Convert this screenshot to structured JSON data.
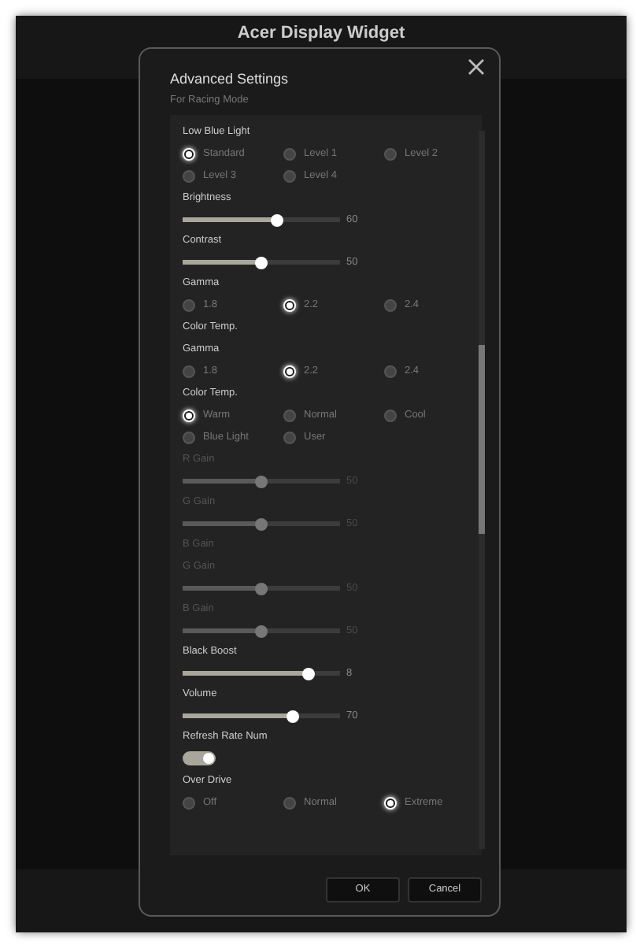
{
  "app": {
    "title": "Acer Display Widget"
  },
  "dialog": {
    "title": "Advanced Settings",
    "subtitle": "For Racing Mode",
    "sections": [
      {
        "kind": "radio",
        "label": "Low Blue Light",
        "options": [
          {
            "label": "Standard",
            "selected": true
          },
          {
            "label": "Level 1",
            "selected": false
          },
          {
            "label": "Level 2",
            "selected": false
          },
          {
            "label": "Level 3",
            "selected": false
          },
          {
            "label": "Level 4",
            "selected": false
          }
        ]
      },
      {
        "kind": "slider",
        "label": "Brightness",
        "disabled": false,
        "level": 0.6,
        "reading": "60"
      },
      {
        "kind": "slider",
        "label": "Contrast",
        "disabled": false,
        "level": 0.5,
        "reading": "50"
      },
      {
        "kind": "radio",
        "label": "Gamma",
        "options": [
          {
            "label": "1.8",
            "selected": false
          },
          {
            "label": "2.2",
            "selected": true
          },
          {
            "label": "2.4",
            "selected": false
          }
        ]
      },
      {
        "kind": "heading",
        "label": "Color Temp.",
        "disabled": false
      },
      {
        "kind": "radio",
        "label": "Gamma",
        "options": [
          {
            "label": "1.8",
            "selected": false
          },
          {
            "label": "2.2",
            "selected": true
          },
          {
            "label": "2.4",
            "selected": false
          }
        ]
      },
      {
        "kind": "radio",
        "label": "Color Temp.",
        "options": [
          {
            "label": "Warm",
            "selected": true
          },
          {
            "label": "Normal",
            "selected": false
          },
          {
            "label": "Cool",
            "selected": false
          },
          {
            "label": "Blue Light",
            "selected": false
          },
          {
            "label": "User",
            "selected": false
          }
        ]
      },
      {
        "kind": "slider",
        "label": "R Gain",
        "disabled": true,
        "level": 0.5,
        "reading": "50"
      },
      {
        "kind": "slider",
        "label": "G Gain",
        "disabled": true,
        "level": 0.5,
        "reading": "50"
      },
      {
        "kind": "heading",
        "label": "B Gain",
        "disabled": true
      },
      {
        "kind": "slider",
        "label": "G Gain",
        "disabled": true,
        "level": 0.5,
        "reading": "50"
      },
      {
        "kind": "slider",
        "label": "B Gain",
        "disabled": true,
        "level": 0.5,
        "reading": "50"
      },
      {
        "kind": "slider",
        "label": "Black Boost",
        "disabled": false,
        "level": 0.8,
        "reading": "8"
      },
      {
        "kind": "slider",
        "label": "Volume",
        "disabled": false,
        "level": 0.7,
        "reading": "70"
      },
      {
        "kind": "toggle",
        "label": "Refresh Rate Num",
        "on": true
      },
      {
        "kind": "radio",
        "label": "Over Drive",
        "options": [
          {
            "label": "Off",
            "selected": false
          },
          {
            "label": "Normal",
            "selected": false
          },
          {
            "label": "Extreme",
            "selected": true
          }
        ]
      }
    ],
    "buttons": [
      {
        "label": "OK"
      },
      {
        "label": "Cancel"
      }
    ]
  }
}
